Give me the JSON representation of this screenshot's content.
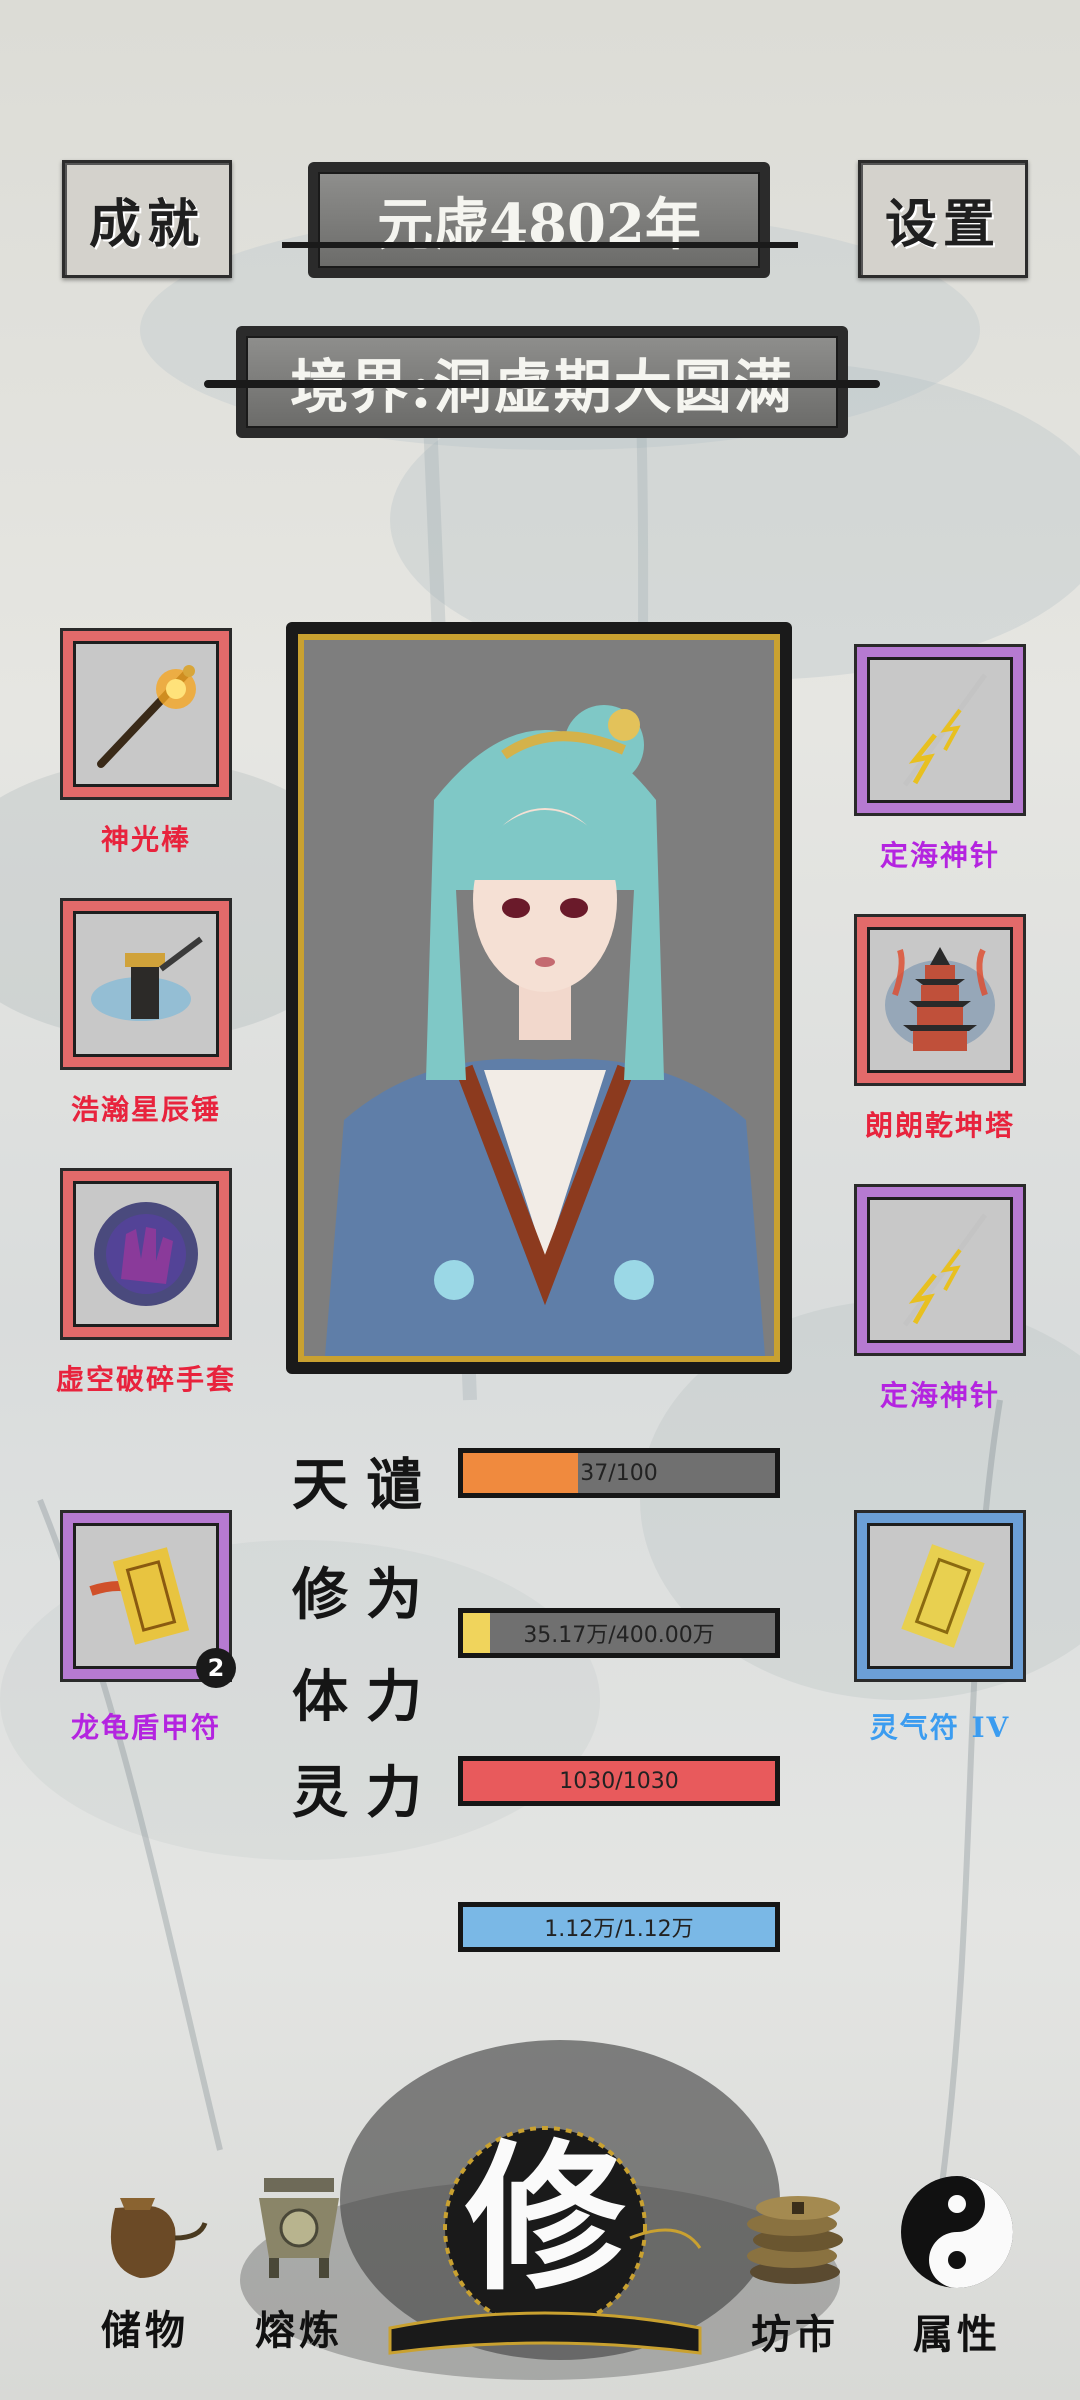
{
  "header": {
    "achievements_label": "成就",
    "year_label": "元虚4802年",
    "settings_label": "设置"
  },
  "realm": {
    "label": "境界:洞虚期大圆满"
  },
  "equipment": {
    "left": [
      {
        "name": "神光棒",
        "rarity": "red",
        "icon": "staff-icon"
      },
      {
        "name": "浩瀚星辰锤",
        "rarity": "red",
        "icon": "hammer-icon"
      },
      {
        "name": "虚空破碎手套",
        "rarity": "red",
        "icon": "gauntlet-icon"
      }
    ],
    "right": [
      {
        "name": "定海神针",
        "rarity": "purple",
        "icon": "lightning-spear-icon"
      },
      {
        "name": "朗朗乾坤塔",
        "rarity": "red",
        "icon": "pagoda-icon"
      },
      {
        "name": "定海神针",
        "rarity": "purple",
        "icon": "lightning-spear-icon"
      }
    ]
  },
  "talismans": {
    "left": {
      "name": "龙龟盾甲符",
      "rarity": "purple",
      "count": "2",
      "icon": "talisman-icon"
    },
    "right": {
      "name": "灵气符 IV",
      "rarity": "blue",
      "icon": "talisman-icon"
    }
  },
  "stats": [
    {
      "label": "天谴",
      "text": "37/100",
      "fill": 0.37,
      "color": "#f08a3e"
    },
    {
      "label": "修为",
      "text": "35.17万/400.00万",
      "fill": 0.088,
      "color": "#f0d45c"
    },
    {
      "label": "体力",
      "text": "1030/1030",
      "fill": 1.0,
      "color": "#e85a5c"
    },
    {
      "label": "灵力",
      "text": "1.12万/1.12万",
      "fill": 1.0,
      "color": "#7ab8e6"
    }
  ],
  "nav": {
    "storage": "储物",
    "smelt": "熔炼",
    "cultivate": "修",
    "market": "坊市",
    "attributes": "属性"
  },
  "colors": {
    "slot_red": "#e26a6a",
    "slot_purple": "#b67ad1",
    "slot_blue": "#6c9fd6",
    "gold_frame": "#c9a130"
  }
}
